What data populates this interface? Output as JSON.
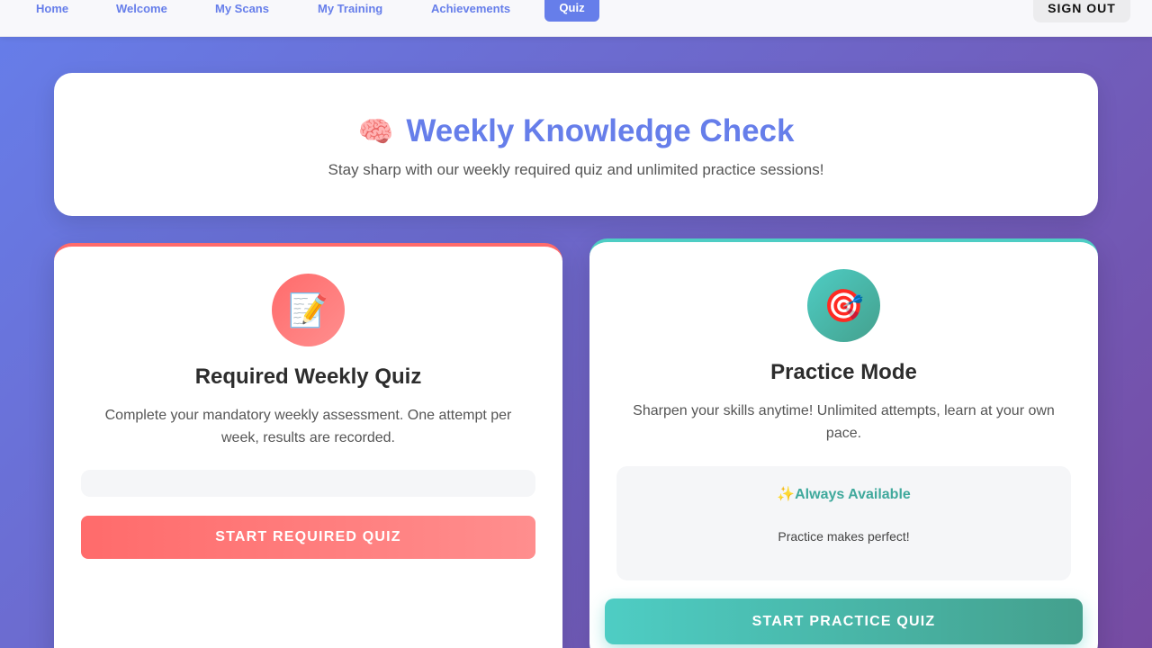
{
  "nav": {
    "links": [
      "Home",
      "Welcome",
      "My Scans",
      "My Training",
      "Achievements"
    ],
    "active": "Quiz",
    "sign_out": "SIGN OUT"
  },
  "header": {
    "icon": "brain-icon",
    "emoji": "🧠",
    "title": "Weekly Knowledge Check",
    "subtitle": "Stay sharp with our weekly required quiz and unlimited practice sessions!"
  },
  "required": {
    "icon": "memo-icon",
    "emoji": "📝",
    "title": "Required Weekly Quiz",
    "description": "Complete your mandatory weekly assessment. One attempt per week, results are recorded.",
    "button": "START REQUIRED QUIZ",
    "accent": "#ff6b6b"
  },
  "practice": {
    "icon": "target-icon",
    "emoji": "🎯",
    "title": "Practice Mode",
    "description": "Sharpen your skills anytime! Unlimited attempts, learn at your own pace.",
    "availability_title": "✨Always Available",
    "availability_sub": "Practice makes perfect!",
    "button": "START PRACTICE QUIZ",
    "accent": "#4ecdc4"
  }
}
